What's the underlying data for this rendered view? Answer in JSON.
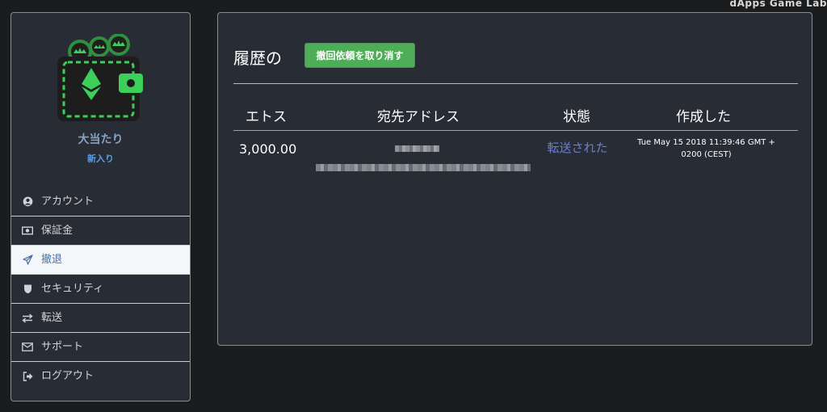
{
  "watermark": "dApps Game Lab",
  "sidebar": {
    "username": "大当たり",
    "rank": "新入り",
    "items": [
      {
        "label": "アカウント",
        "icon": "user-circle-icon"
      },
      {
        "label": "保証金",
        "icon": "money-icon"
      },
      {
        "label": "撤退",
        "icon": "paper-plane-icon",
        "active": true
      },
      {
        "label": "セキュリティ",
        "icon": "shield-icon"
      },
      {
        "label": "転送",
        "icon": "exchange-icon"
      },
      {
        "label": "サポート",
        "icon": "envelope-icon"
      },
      {
        "label": "ログアウト",
        "icon": "sign-out-icon"
      }
    ]
  },
  "main": {
    "title": "履歴の",
    "cancel_button": "撤回依頼を取り消す",
    "columns": [
      "エトス",
      "宛先アドレス",
      "状態",
      "作成した"
    ],
    "rows": [
      {
        "amount": "3,000.00",
        "status": "転送された",
        "created": "Tue May 15 2018 11:39:46 GMT + 0200 (CEST)"
      }
    ]
  },
  "colors": {
    "accent_green": "#4eae57",
    "status_blue": "#6a7ed6",
    "rank_blue": "#5c9de0",
    "panel_bg": "#282c34"
  }
}
